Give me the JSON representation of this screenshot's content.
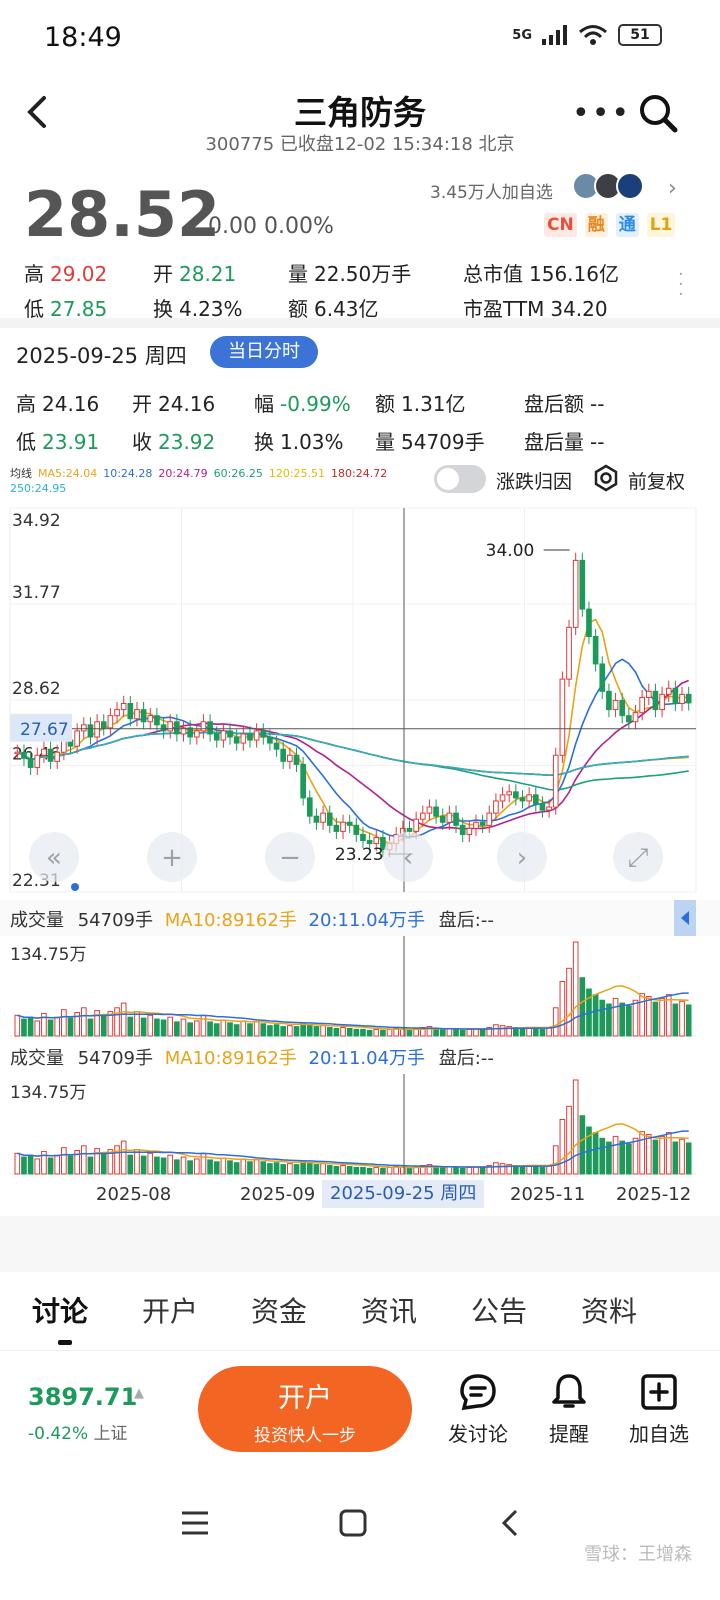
{
  "status": {
    "time": "18:49",
    "network": "5G",
    "battery": "51"
  },
  "header": {
    "title": "三角防务",
    "subtitle": "300775 已收盘12-02 15:34:18 北京"
  },
  "quote": {
    "price": "28.52",
    "change": "0.00 0.00%",
    "followers": "3.45万人加自选",
    "tags": [
      {
        "text": "CN",
        "color": "#e8503a",
        "bg": "#fde8e4"
      },
      {
        "text": "融",
        "color": "#e8881e",
        "bg": "#fdf0e0"
      },
      {
        "text": "通",
        "color": "#2a8be0",
        "bg": "#e3f0fc"
      },
      {
        "text": "L1",
        "color": "#e0a313",
        "bg": "#fdf5dc"
      }
    ],
    "rows": [
      [
        {
          "k": "高",
          "v": "29.02",
          "c": "red"
        },
        {
          "k": "开",
          "v": "28.21",
          "c": "green"
        },
        {
          "k": "量",
          "v": "22.50万手",
          "c": ""
        },
        {
          "k": "总市值",
          "v": "156.16亿",
          "c": ""
        }
      ],
      [
        {
          "k": "低",
          "v": "27.85",
          "c": "green"
        },
        {
          "k": "换",
          "v": "4.23%",
          "c": ""
        },
        {
          "k": "额",
          "v": "6.43亿",
          "c": ""
        },
        {
          "k": "市盈TTM",
          "v": "34.20",
          "c": ""
        }
      ]
    ]
  },
  "day": {
    "date": "2025-09-25 周四",
    "pill": "当日分时",
    "rows": [
      [
        {
          "k": "高",
          "v": "24.16",
          "c": ""
        },
        {
          "k": "开",
          "v": "24.16",
          "c": ""
        },
        {
          "k": "幅",
          "v": "-0.99%",
          "c": "green"
        },
        {
          "k": "额",
          "v": "1.31亿",
          "c": ""
        },
        {
          "k": "盘后额",
          "v": "--",
          "c": ""
        }
      ],
      [
        {
          "k": "低",
          "v": "23.91",
          "c": "green"
        },
        {
          "k": "收",
          "v": "23.92",
          "c": "green"
        },
        {
          "k": "换",
          "v": "1.03%",
          "c": ""
        },
        {
          "k": "量",
          "v": "54709手",
          "c": ""
        },
        {
          "k": "盘后量",
          "v": "--",
          "c": ""
        }
      ]
    ]
  },
  "ma": {
    "label": "均线",
    "items": [
      {
        "text": "MA5:24.04",
        "color": "#e8a317"
      },
      {
        "text": "10:24.28",
        "color": "#2a6fdb"
      },
      {
        "text": "20:24.79",
        "color": "#b0208f"
      },
      {
        "text": "60:26.25",
        "color": "#1aa07a"
      },
      {
        "text": "120:25.51",
        "color": "#e8b800"
      },
      {
        "text": "180:24.72",
        "color": "#c62828"
      }
    ],
    "line2": {
      "text": "250:24.95",
      "color": "#27b3c7"
    }
  },
  "controls": {
    "toggle_label": "涨跌归因",
    "fq_label": "前复权"
  },
  "chart_data": {
    "type": "candlestick",
    "y_ticks": [
      "34.92",
      "31.77",
      "28.62",
      "26.46",
      "22.31"
    ],
    "crosshair_price": "27.67",
    "high_label": "34.00",
    "low_label": "23.23",
    "x_ticks": [
      "2025-08",
      "2025-09",
      "2025-11",
      "2025-12"
    ],
    "crosshair_date": "2025-09-25 周四",
    "ylim": [
      22.31,
      34.92
    ],
    "closes": [
      26.9,
      26.7,
      26.4,
      26.8,
      27.0,
      26.6,
      26.9,
      27.3,
      27.1,
      27.6,
      27.8,
      27.4,
      27.9,
      27.7,
      28.1,
      28.3,
      28.5,
      28.0,
      28.3,
      27.9,
      28.1,
      27.8,
      27.6,
      27.9,
      27.5,
      27.7,
      27.4,
      27.6,
      27.9,
      27.5,
      27.3,
      27.6,
      27.4,
      27.2,
      27.5,
      27.3,
      27.6,
      27.4,
      27.2,
      27.0,
      26.6,
      26.8,
      26.5,
      25.4,
      24.8,
      24.6,
      24.9,
      24.5,
      24.3,
      24.6,
      24.5,
      24.2,
      24.0,
      23.9,
      24.1,
      23.7,
      23.9,
      24.2,
      24.4,
      24.3,
      24.7,
      24.9,
      25.1,
      24.8,
      24.6,
      24.9,
      24.5,
      24.2,
      24.4,
      24.6,
      24.5,
      24.9,
      25.3,
      25.5,
      25.6,
      25.4,
      25.3,
      25.5,
      25.2,
      25.0,
      25.1,
      26.8,
      29.3,
      31.0,
      33.2,
      31.6,
      30.7,
      29.8,
      28.9,
      28.3,
      28.6,
      28.1,
      27.9,
      28.2,
      28.7,
      28.9,
      28.3,
      28.8,
      29.0,
      28.5,
      28.8,
      28.52
    ],
    "volume_label": "134.75万",
    "volume_ma10_label": "MA10:89162手",
    "volumes": [
      0.22,
      0.18,
      0.2,
      0.16,
      0.24,
      0.17,
      0.2,
      0.28,
      0.19,
      0.25,
      0.3,
      0.18,
      0.27,
      0.21,
      0.26,
      0.3,
      0.35,
      0.2,
      0.26,
      0.19,
      0.22,
      0.18,
      0.17,
      0.2,
      0.15,
      0.18,
      0.14,
      0.16,
      0.22,
      0.15,
      0.13,
      0.17,
      0.14,
      0.12,
      0.16,
      0.13,
      0.15,
      0.13,
      0.11,
      0.12,
      0.1,
      0.11,
      0.1,
      0.14,
      0.12,
      0.1,
      0.11,
      0.09,
      0.08,
      0.09,
      0.08,
      0.07,
      0.07,
      0.06,
      0.07,
      0.06,
      0.07,
      0.08,
      0.07,
      0.06,
      0.08,
      0.09,
      0.1,
      0.08,
      0.07,
      0.08,
      0.07,
      0.06,
      0.07,
      0.08,
      0.07,
      0.09,
      0.12,
      0.11,
      0.1,
      0.09,
      0.08,
      0.09,
      0.08,
      0.07,
      0.09,
      0.3,
      0.58,
      0.72,
      1.0,
      0.62,
      0.5,
      0.44,
      0.38,
      0.34,
      0.4,
      0.35,
      0.32,
      0.38,
      0.45,
      0.42,
      0.36,
      0.4,
      0.44,
      0.34,
      0.37,
      0.33
    ]
  },
  "volume": {
    "title": "成交量",
    "vol": "54709手",
    "ma10": "MA10:89162手",
    "ma20": "20:11.04万手",
    "after": "盘后:--"
  },
  "tabs": [
    "讨论",
    "开户",
    "资金",
    "资讯",
    "公告",
    "资料"
  ],
  "bottom": {
    "index_value": "3897.71",
    "index_change": "-0.42%",
    "index_name": "上证",
    "open_title": "开户",
    "open_sub": "投资快人一步",
    "actions": [
      "发讨论",
      "提醒",
      "加自选"
    ]
  },
  "watermark": "雪球：王增森"
}
